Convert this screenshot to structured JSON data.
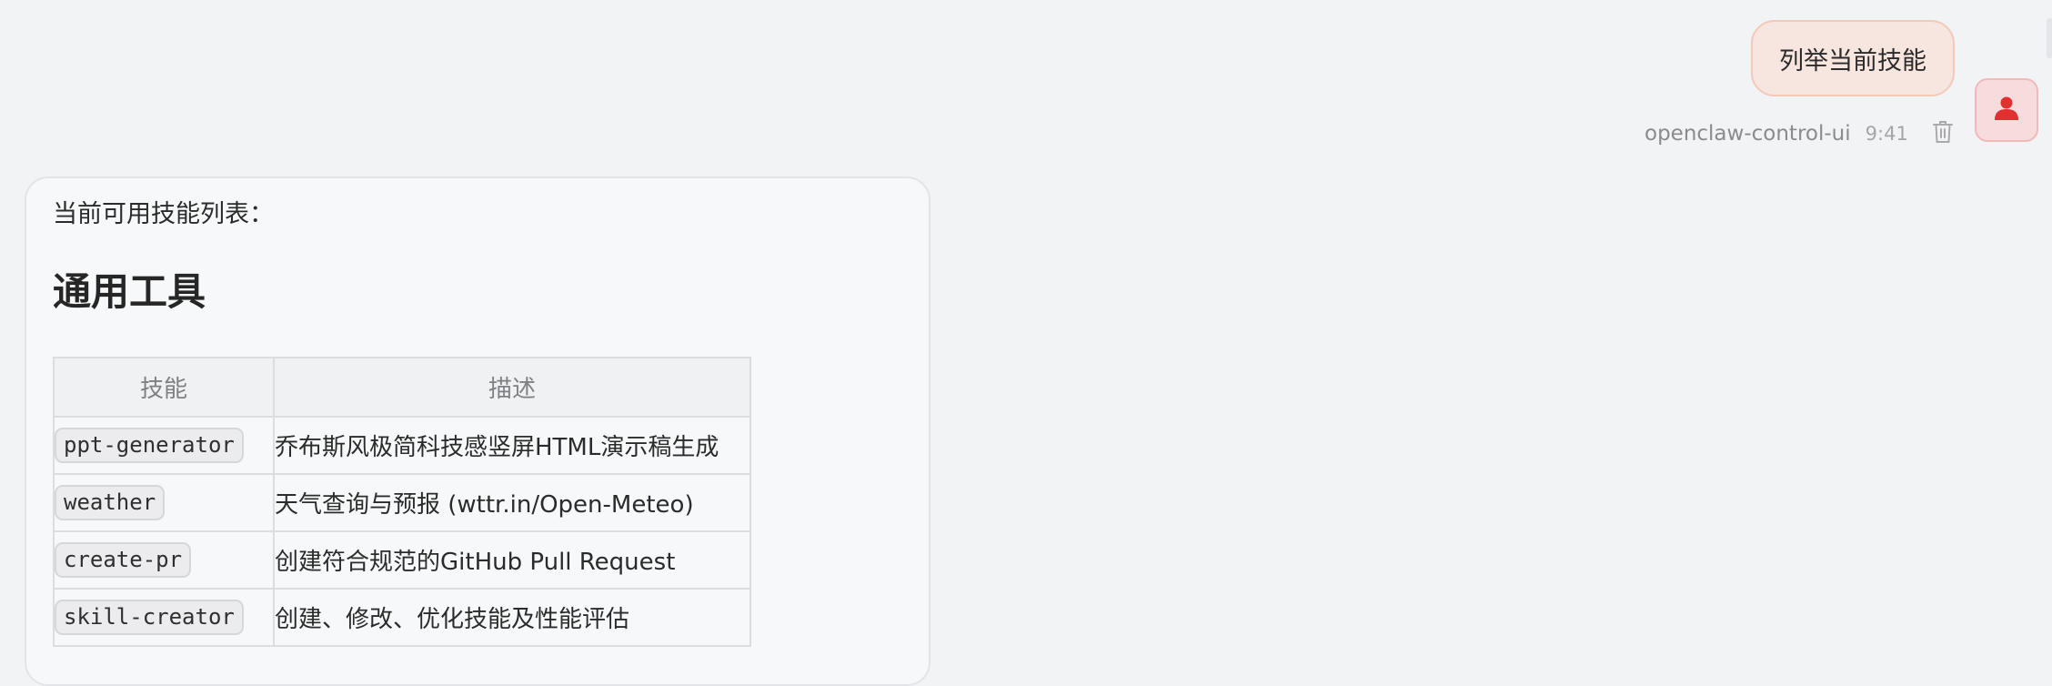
{
  "user_message": {
    "text": "列举当前技能",
    "sender": "openclaw-control-ui",
    "time": "9:41"
  },
  "icons": {
    "avatar": "user-icon",
    "delete": "trash-icon"
  },
  "colors": {
    "user_bubble_bg": "#f7e6df",
    "user_bubble_border": "#f3c9b8",
    "avatar_icon": "#e0302f",
    "page_bg": "#f2f3f5"
  },
  "assistant_message": {
    "intro": "当前可用技能列表：",
    "section_title": "通用工具",
    "table": {
      "headers": [
        "技能",
        "描述"
      ],
      "rows": [
        {
          "skill": "ppt-generator",
          "description": "乔布斯风极简科技感竖屏HTML演示稿生成"
        },
        {
          "skill": "weather",
          "description": "天气查询与预报 (wttr.in/Open-Meteo)"
        },
        {
          "skill": "create-pr",
          "description": "创建符合规范的GitHub Pull Request"
        },
        {
          "skill": "skill-creator",
          "description": "创建、修改、优化技能及性能评估"
        }
      ]
    }
  }
}
